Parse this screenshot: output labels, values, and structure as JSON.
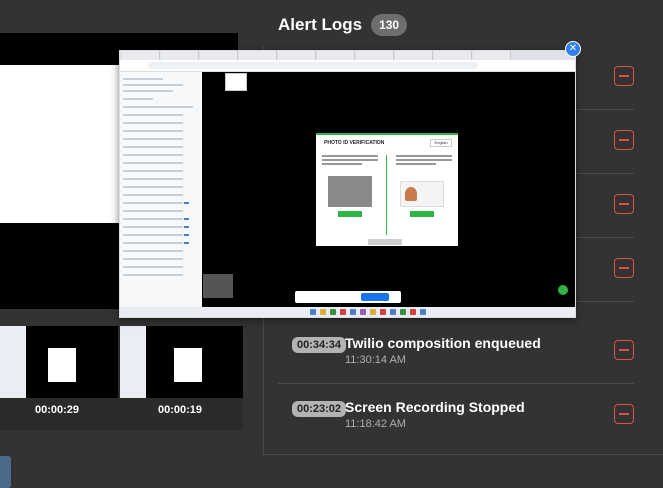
{
  "header": {
    "title": "Alert Logs",
    "count": "130"
  },
  "preview": {
    "dialog_title": "PHOTO ID VERIFICATION",
    "dialog_lang": "English",
    "close_icon": "close-icon"
  },
  "thumbnails": [
    {
      "label": "00:00:29"
    },
    {
      "label": "00:00:19"
    }
  ],
  "logs": [
    {
      "badge": "00:34:34",
      "title": "Twilio composition enqueued",
      "time": "11:30:14 AM"
    },
    {
      "badge": "00:23:02",
      "title": "Screen Recording Stopped",
      "time": "11:18:42 AM"
    }
  ],
  "colors": {
    "background": "#333333",
    "badge": "#6e6e6e",
    "remove_accent": "#e0504a",
    "close_blue": "#2f80ed",
    "verify_green": "#2fb344"
  }
}
